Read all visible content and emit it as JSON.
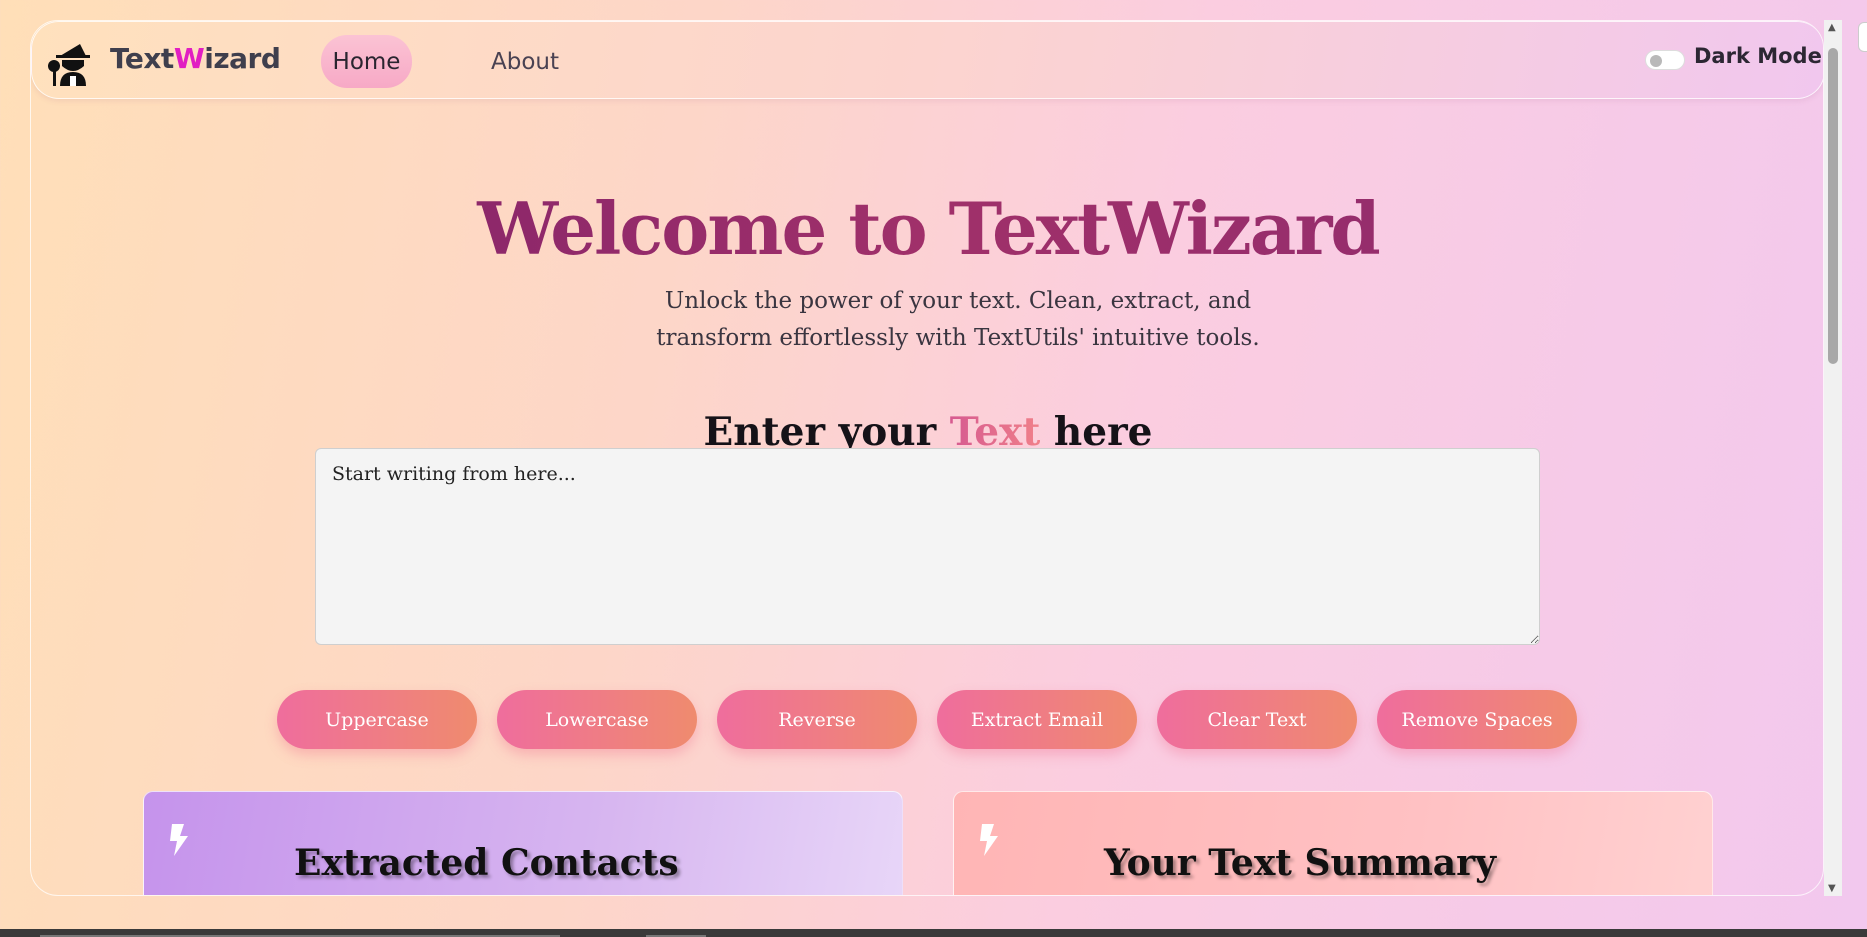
{
  "navbar": {
    "brand_prefix": "Text",
    "brand_w": "W",
    "brand_suffix": "izard",
    "logo_icon": "wizard-icon",
    "links": [
      "Home",
      "About"
    ],
    "dark_mode_label": "Dark Mode",
    "dark_mode_on": false
  },
  "hero": {
    "title": "Welcome to TextWizard",
    "subtitle": "Unlock the power of your text. Clean, extract, and transform effortlessly with TextUtils' intuitive tools."
  },
  "editor": {
    "heading_pre": "Enter your ",
    "heading_accent": "Text",
    "heading_post": " here",
    "placeholder": "Start writing from here..."
  },
  "actions": [
    "Uppercase",
    "Lowercase",
    "Reverse",
    "Extract Email",
    "Clear Text",
    "Remove Spaces"
  ],
  "cards": [
    {
      "title": "Extracted Contacts",
      "icon": "bolt-icon"
    },
    {
      "title": "Your Text Summary",
      "icon": "bolt-icon"
    }
  ],
  "colors": {
    "brand_accent": "#e11ec2",
    "button_gradient_start": "#ef6d9d",
    "button_gradient_end": "#ef8b6e",
    "title_color": "#8c2a6e"
  }
}
